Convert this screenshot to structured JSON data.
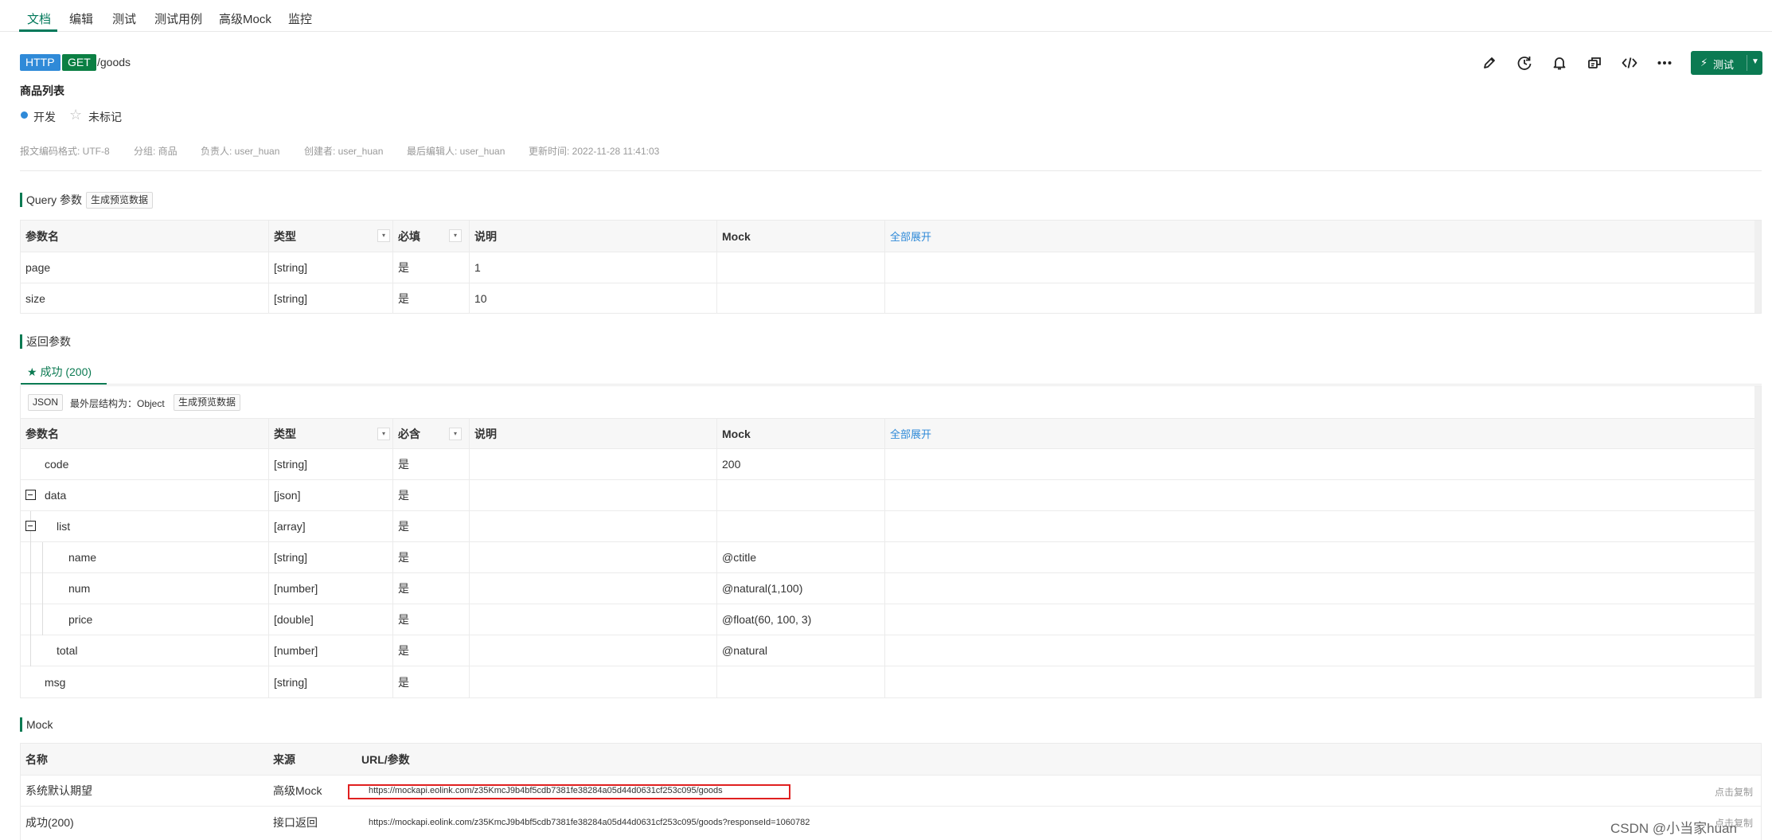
{
  "tabs": [
    "文档",
    "编辑",
    "测试",
    "测试用例",
    "高级Mock",
    "监控"
  ],
  "header": {
    "protocol": "HTTP",
    "method": "GET",
    "path": "/goods",
    "title": "商品列表",
    "status": "开发",
    "star_label": "未标记",
    "test_button": "测试"
  },
  "meta": {
    "encoding": "报文编码格式: UTF-8",
    "group": "分组: 商品",
    "owner": "负责人: user_huan",
    "creator": "创建者: user_huan",
    "editor": "最后编辑人: user_huan",
    "updated": "更新时间: 2022-11-28 11:41:03"
  },
  "query": {
    "title": "Query 参数",
    "gen_btn": "生成预览数据",
    "headers": [
      "参数名",
      "类型",
      "必填",
      "说明",
      "Mock"
    ],
    "expand_all": "全部展开",
    "rows": [
      {
        "name": "page",
        "type": "[string]",
        "required": "是",
        "desc": "1",
        "mock": ""
      },
      {
        "name": "size",
        "type": "[string]",
        "required": "是",
        "desc": "10",
        "mock": ""
      }
    ]
  },
  "response": {
    "title": "返回参数",
    "tab": "成功 (200)",
    "format": "JSON",
    "outer": "最外层结构为：Object",
    "gen_btn": "生成预览数据",
    "headers": [
      "参数名",
      "类型",
      "必含",
      "说明",
      "Mock"
    ],
    "expand_all": "全部展开",
    "rows": [
      {
        "name": "code",
        "type": "[string]",
        "required": "是",
        "desc": "",
        "mock": "200"
      },
      {
        "name": "data",
        "type": "[json]",
        "required": "是",
        "desc": "",
        "mock": ""
      },
      {
        "name": "list",
        "type": "[array]",
        "required": "是",
        "desc": "",
        "mock": ""
      },
      {
        "name": "name",
        "type": "[string]",
        "required": "是",
        "desc": "",
        "mock": "@ctitle"
      },
      {
        "name": "num",
        "type": "[number]",
        "required": "是",
        "desc": "",
        "mock": "@natural(1,100)"
      },
      {
        "name": "price",
        "type": "[double]",
        "required": "是",
        "desc": "",
        "mock": "@float(60, 100, 3)"
      },
      {
        "name": "total",
        "type": "[number]",
        "required": "是",
        "desc": "",
        "mock": "@natural"
      },
      {
        "name": "msg",
        "type": "[string]",
        "required": "是",
        "desc": "",
        "mock": ""
      }
    ]
  },
  "mock": {
    "title": "Mock",
    "headers": [
      "名称",
      "来源",
      "URL/参数"
    ],
    "rows": [
      {
        "name": "系统默认期望",
        "source": "高级Mock",
        "url": "https://mockapi.eolink.com/z35KmcJ9b4bf5cdb7381fe38284a05d44d0631cf253c095/goods",
        "action": "点击复制"
      },
      {
        "name": "成功(200)",
        "source": "接口返回",
        "url": "https://mockapi.eolink.com/z35KmcJ9b4bf5cdb7381fe38284a05d44d0631cf253c095/goods?responseId=1060782",
        "action": "点击复制"
      }
    ]
  },
  "watermark": "CSDN @小当家huan",
  "colors": {
    "accent": "#0b7a52",
    "http": "#2f8ad8",
    "get": "#0b7f43",
    "link": "#2f8ad8",
    "highlight": "#e02020"
  },
  "icons": [
    "edit-icon",
    "history-icon",
    "bell-icon",
    "share-icon",
    "code-icon",
    "more-icon"
  ]
}
